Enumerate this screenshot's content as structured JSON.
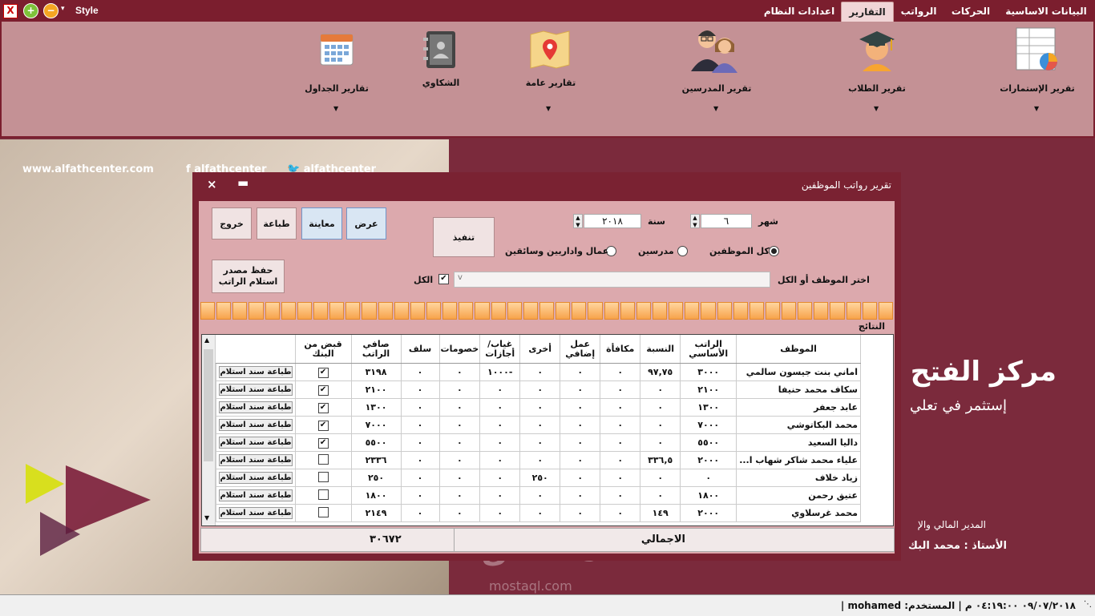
{
  "tabbar": {
    "style_label": "Style",
    "tabs": [
      "البيانات الاساسية",
      "الحركات",
      "الرواتب",
      "التقارير",
      "اعدادات النظام"
    ],
    "active_tab": "التقارير"
  },
  "ribbon": {
    "items": [
      {
        "label": "تقرير الإستمارات",
        "icon": "spreadsheet-chart-icon"
      },
      {
        "label": "تقرير الطلاب",
        "icon": "graduate-student-icon"
      },
      {
        "label": "تقرير المدرسين",
        "icon": "teachers-icon"
      },
      {
        "label": "تقارير عامة",
        "icon": "map-pin-icon"
      },
      {
        "label": "الشكاوي",
        "icon": "address-book-icon"
      },
      {
        "label": "تقارير الجداول",
        "icon": "calendar-icon"
      }
    ]
  },
  "background": {
    "website": "www.alfathcenter.com",
    "facebook": "alfathcenter",
    "twitter": "alfathcenter",
    "brand_title": "مركز الفتح",
    "brand_sub": "إستثمر في تعلي",
    "manager_line": "المدير المالي والإ",
    "manager_name": "الأستاذ : محمد البك",
    "watermark": "مستقل",
    "watermark_url": "mostaql.com"
  },
  "dialog": {
    "title": "تقرير رواتب الموظفين",
    "buttons": {
      "view": "عرض",
      "preview": "معاينة",
      "print": "طباعة",
      "exit": "خروج",
      "execute": "تنفيذ",
      "save_source_line1": "حفظ مصدر",
      "save_source_line2": "استلام الراتب"
    },
    "month_label": "شهر",
    "month_value": "٦",
    "year_label": "سنة",
    "year_value": "٢٠١٨",
    "radio_all": "كل الموظفين",
    "radio_teachers": "مدرسين",
    "radio_workers": "عمال واداريين وسائقين",
    "select_label": "اختر الموظف أو الكل",
    "all_label": "الكل",
    "results_label": "النتائج",
    "total_label": "الاجمالي",
    "total_value": "٣٠٦٧٢"
  },
  "table": {
    "headers": [
      "الموظف",
      "الراتب الأساسي",
      "النسبة",
      "مكافأة",
      "عمل إضافي",
      "أخرى",
      "غياب/أجازات",
      "خصومات",
      "سلف",
      "صافي الراتب",
      "قبض من البنك",
      ""
    ],
    "print_label": "طباعة سند استلام",
    "rows": [
      {
        "name": "اماني بنت جيسون سالمي",
        "basic": "٣٠٠٠",
        "ratio": "٩٧,٧٥",
        "bonus": "٠",
        "overtime": "٠",
        "other": "٠",
        "absence": "-١٠٠٠",
        "deductions": "٠",
        "advance": "٠",
        "net": "٣١٩٨",
        "bank": true
      },
      {
        "name": "سكاف محمد حنيفا",
        "basic": "٢١٠٠",
        "ratio": "٠",
        "bonus": "٠",
        "overtime": "٠",
        "other": "٠",
        "absence": "٠",
        "deductions": "٠",
        "advance": "٠",
        "net": "٢١٠٠",
        "bank": true
      },
      {
        "name": "عابد جعفر",
        "basic": "١٣٠٠",
        "ratio": "٠",
        "bonus": "٠",
        "overtime": "٠",
        "other": "٠",
        "absence": "٠",
        "deductions": "٠",
        "advance": "٠",
        "net": "١٣٠٠",
        "bank": true
      },
      {
        "name": "محمد البكاتوشي",
        "basic": "٧٠٠٠",
        "ratio": "٠",
        "bonus": "٠",
        "overtime": "٠",
        "other": "٠",
        "absence": "٠",
        "deductions": "٠",
        "advance": "٠",
        "net": "٧٠٠٠",
        "bank": true
      },
      {
        "name": "داليا السعيد",
        "basic": "٥٥٠٠",
        "ratio": "٠",
        "bonus": "٠",
        "overtime": "٠",
        "other": "٠",
        "absence": "٠",
        "deductions": "٠",
        "advance": "٠",
        "net": "٥٥٠٠",
        "bank": true
      },
      {
        "name": "علياء محمد شاكر شهاب ا...",
        "basic": "٢٠٠٠",
        "ratio": "٣٣٦,٥",
        "bonus": "٠",
        "overtime": "٠",
        "other": "٠",
        "absence": "٠",
        "deductions": "٠",
        "advance": "٠",
        "net": "٢٣٣٦",
        "bank": false
      },
      {
        "name": "زياد خلاف",
        "basic": "٠",
        "ratio": "٠",
        "bonus": "٠",
        "overtime": "٠",
        "other": "٢٥٠",
        "absence": "٠",
        "deductions": "٠",
        "advance": "٠",
        "net": "٢٥٠",
        "bank": false
      },
      {
        "name": "عتيق رحمن",
        "basic": "١٨٠٠",
        "ratio": "٠",
        "bonus": "٠",
        "overtime": "٠",
        "other": "٠",
        "absence": "٠",
        "deductions": "٠",
        "advance": "٠",
        "net": "١٨٠٠",
        "bank": false
      },
      {
        "name": "محمد غرسلاوي",
        "basic": "٢٠٠٠",
        "ratio": "١٤٩",
        "bonus": "٠",
        "overtime": "٠",
        "other": "٠",
        "absence": "٠",
        "deductions": "٠",
        "advance": "٠",
        "net": "٢١٤٩",
        "bank": false
      }
    ]
  },
  "statusbar": {
    "text": "٠٩/٠٧/٢٠١٨ ٠٤:١٩:٠٠ م | المستخدم: mohamed |"
  }
}
